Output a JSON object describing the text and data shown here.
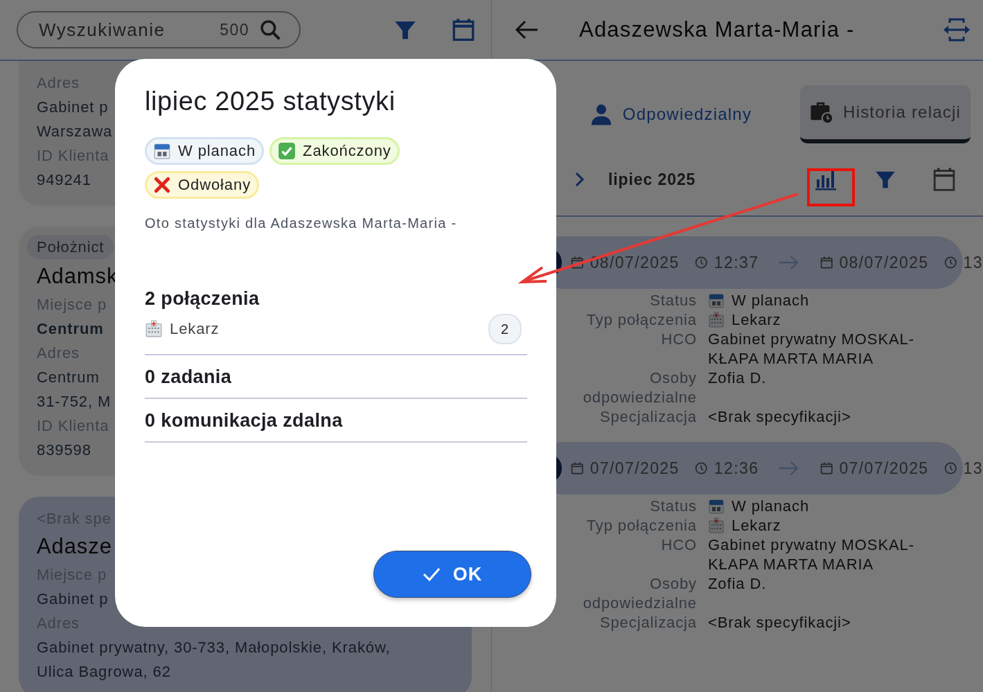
{
  "search": {
    "placeholder": "Wyszukiwanie",
    "count": "500"
  },
  "client_cards": [
    {
      "selected": false,
      "fields": [
        {
          "kind": "label",
          "text": "Adres"
        },
        {
          "kind": "value",
          "text": "Gabinet p"
        },
        {
          "kind": "value",
          "text": "Warszawa"
        },
        {
          "kind": "label",
          "text": "ID Klienta"
        },
        {
          "kind": "value",
          "text": "949241"
        }
      ]
    },
    {
      "selected": false,
      "fields": [
        {
          "kind": "chip",
          "text": "Położnict"
        },
        {
          "kind": "name",
          "text": "Adamsk"
        },
        {
          "kind": "label",
          "text": "Miejsce p"
        },
        {
          "kind": "strong",
          "text": "Centrum"
        },
        {
          "kind": "label",
          "text": "Adres"
        },
        {
          "kind": "value",
          "text": "Centrum"
        },
        {
          "kind": "value",
          "text": "31-752, M"
        },
        {
          "kind": "label",
          "text": "ID Klienta"
        },
        {
          "kind": "value",
          "text": "839598"
        }
      ]
    },
    {
      "selected": true,
      "fields": [
        {
          "kind": "label",
          "text": "<Brak spe"
        },
        {
          "kind": "name",
          "text": "Adasze"
        },
        {
          "kind": "label",
          "text": "Miejsce p"
        },
        {
          "kind": "value",
          "text": "Gabinet p"
        },
        {
          "kind": "label",
          "text": "Adres"
        },
        {
          "kind": "value",
          "text": "Gabinet prywatny, 30-733, Małopolskie, Kraków,"
        },
        {
          "kind": "value",
          "text": "Ulica Bagrowa, 62"
        }
      ]
    }
  ],
  "detail": {
    "title": "Adaszewska Marta-Maria -",
    "tabs": [
      {
        "label": "Odpowiedzialny",
        "kind": "person",
        "selected": false
      },
      {
        "label": "Historia relacji",
        "kind": "history",
        "selected": true
      }
    ],
    "month": "lipiec 2025",
    "entries": [
      {
        "start_date": "08/07/2025",
        "start_time": "12:37",
        "end_date": "08/07/2025",
        "end_time": "13",
        "fields": [
          {
            "label": "Status",
            "kind": "planned",
            "value": "W planach"
          },
          {
            "label": "Typ połączenia",
            "kind": "doctor",
            "value": "Lekarz"
          },
          {
            "label": "HCO",
            "kind": "text",
            "value": "Gabinet prywatny MOSKAL-KŁAPA MARTA MARIA"
          },
          {
            "label": "Osoby odpowiedzialne",
            "kind": "text",
            "value": "Zofia D."
          },
          {
            "label": "Specjalizacja",
            "kind": "text",
            "value": "<Brak specyfikacji>"
          }
        ]
      },
      {
        "start_date": "07/07/2025",
        "start_time": "12:36",
        "end_date": "07/07/2025",
        "end_time": "13",
        "fields": [
          {
            "label": "Status",
            "kind": "planned",
            "value": "W planach"
          },
          {
            "label": "Typ połączenia",
            "kind": "doctor",
            "value": "Lekarz"
          },
          {
            "label": "HCO",
            "kind": "text",
            "value": "Gabinet prywatny MOSKAL-KŁAPA MARTA MARIA"
          },
          {
            "label": "Osoby odpowiedzialne",
            "kind": "text",
            "value": "Zofia D."
          },
          {
            "label": "Specjalizacja",
            "kind": "text",
            "value": "<Brak specyfikacji>"
          }
        ]
      }
    ]
  },
  "dialog": {
    "title": "lipiec 2025 statystyki",
    "legend": [
      {
        "kind": "planned",
        "label": "W planach",
        "color": "#d3e2f1"
      },
      {
        "kind": "done",
        "label": "Zakończony",
        "color": "#d6f4a4"
      },
      {
        "kind": "cancelled",
        "label": "Odwołany",
        "color": "#f9ec9c"
      }
    ],
    "description": "Oto statystyki dla Adaszewska Marta-Maria -",
    "sections": [
      {
        "title": "2 połączenia",
        "items": [
          {
            "kind": "doctor",
            "label": "Lekarz",
            "count": "2"
          }
        ]
      },
      {
        "title": "0 zadania"
      },
      {
        "title": "0 komunikacja zdalna"
      }
    ],
    "button": {
      "label": "OK"
    }
  }
}
